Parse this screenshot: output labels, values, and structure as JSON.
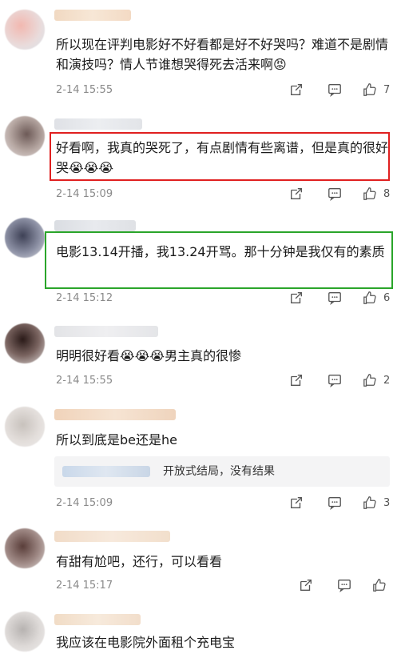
{
  "comments": [
    {
      "text": "所以现在评判电影好不好看都是好不好哭吗？难道不是剧情和演技吗？情人节谁想哭得死去活来啊😡",
      "time": "2-14 15:55",
      "likes": "7"
    },
    {
      "text": "好看啊，我真的哭死了，有点剧情有些离谱，但是真的很好哭😭😭😭",
      "time": "2-14 15:09",
      "likes": "8"
    },
    {
      "text": "电影13.14开播，我13.24开骂。那十分钟是我仅有的素质",
      "time": "2-14 15:12",
      "likes": "6"
    },
    {
      "text": "明明很好看😭😭😭男主真的很惨",
      "time": "2-14 15:55",
      "likes": "2"
    },
    {
      "text": "所以到底是be还是he",
      "reply": "开放式结局，没有结果",
      "time": "2-14 15:09",
      "likes": "3"
    },
    {
      "text": "有甜有尬吧，还行，可以看看",
      "time": "2-14 15:17",
      "likes": ""
    },
    {
      "text": "我应该在电影院外面租个充电宝"
    }
  ]
}
